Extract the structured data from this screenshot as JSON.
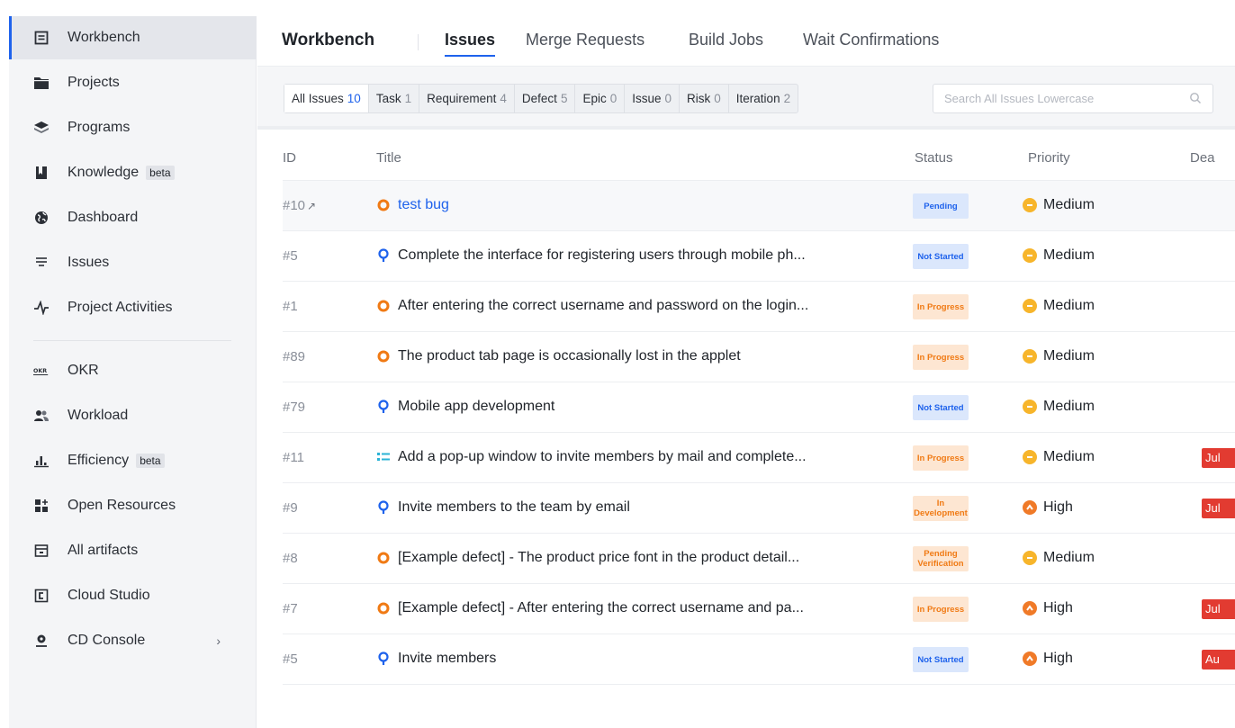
{
  "sidebar": {
    "items": [
      {
        "label": "Workbench",
        "icon": "workbench-icon"
      },
      {
        "label": "Projects",
        "icon": "folder-icon"
      },
      {
        "label": "Programs",
        "icon": "layers-icon"
      },
      {
        "label": "Knowledge",
        "icon": "book-icon",
        "badge": "beta"
      },
      {
        "label": "Dashboard",
        "icon": "globe-icon"
      },
      {
        "label": "Issues",
        "icon": "list-icon"
      },
      {
        "label": "Project Activities",
        "icon": "activity-icon"
      },
      {
        "label": "OKR",
        "icon": "okr-icon"
      },
      {
        "label": "Workload",
        "icon": "users-icon"
      },
      {
        "label": "Efficiency",
        "icon": "bar-chart-icon",
        "badge": "beta"
      },
      {
        "label": "Open Resources",
        "icon": "grid-icon"
      },
      {
        "label": "All artifacts",
        "icon": "package-icon"
      },
      {
        "label": "Cloud Studio",
        "icon": "cloud-studio-icon"
      },
      {
        "label": "CD Console",
        "icon": "deploy-icon",
        "chevron": "›"
      }
    ]
  },
  "header": {
    "title": "Workbench",
    "tabs": [
      {
        "label": "Issues"
      },
      {
        "label": "Merge Requests"
      },
      {
        "label": "Build Jobs"
      },
      {
        "label": "Wait Confirmations"
      }
    ]
  },
  "filters": [
    {
      "label": "All Issues",
      "count": "10"
    },
    {
      "label": "Task",
      "count": "1"
    },
    {
      "label": "Requirement",
      "count": "4"
    },
    {
      "label": "Defect",
      "count": "5"
    },
    {
      "label": "Epic",
      "count": "0"
    },
    {
      "label": "Issue",
      "count": "0"
    },
    {
      "label": "Risk",
      "count": "0"
    },
    {
      "label": "Iteration",
      "count": "2"
    }
  ],
  "search": {
    "placeholder": "Search All Issues Lowercase"
  },
  "table": {
    "headers": {
      "id": "ID",
      "title": "Title",
      "status": "Status",
      "priority": "Priority",
      "deadline": "Dea"
    },
    "rows": [
      {
        "id": "#10",
        "type": "defect",
        "title": "test bug",
        "status": "Pending",
        "priority": "Medium",
        "deadline": ""
      },
      {
        "id": "#5",
        "type": "requirement",
        "title": "Complete the interface for registering users through mobile ph...",
        "status": "Not Started",
        "priority": "Medium",
        "deadline": ""
      },
      {
        "id": "#1",
        "type": "defect",
        "title": "After entering the correct username and password on the login...",
        "status": "In Progress",
        "priority": "Medium",
        "deadline": ""
      },
      {
        "id": "#89",
        "type": "defect",
        "title": "The product tab page is occasionally lost in the applet",
        "status": "In Progress",
        "priority": "Medium",
        "deadline": ""
      },
      {
        "id": "#79",
        "type": "requirement",
        "title": "Mobile app development",
        "status": "Not Started",
        "priority": "Medium",
        "deadline": ""
      },
      {
        "id": "#11",
        "type": "task",
        "title": "Add a pop-up window to invite members by mail and complete...",
        "status": "In Progress",
        "priority": "Medium",
        "deadline": "Jul"
      },
      {
        "id": "#9",
        "type": "requirement",
        "title": "Invite members to the team by email",
        "status": "In Development",
        "priority": "High",
        "deadline": "Jul"
      },
      {
        "id": "#8",
        "type": "defect",
        "title": "[Example defect] - The product price font in the product detail...",
        "status": "Pending Verification",
        "priority": "Medium",
        "deadline": ""
      },
      {
        "id": "#7",
        "type": "defect",
        "title": "[Example defect] - After entering the correct username and pa...",
        "status": "In Progress",
        "priority": "High",
        "deadline": "Jul"
      },
      {
        "id": "#5",
        "type": "requirement",
        "title": "Invite members",
        "status": "Not Started",
        "priority": "High",
        "deadline": "Au"
      }
    ]
  },
  "colors": {
    "accent": "#1e62ec",
    "defect": "#f07a14",
    "requirement": "#1e62ec",
    "task": "#2bb3d6",
    "overdue": "#e23b31"
  }
}
